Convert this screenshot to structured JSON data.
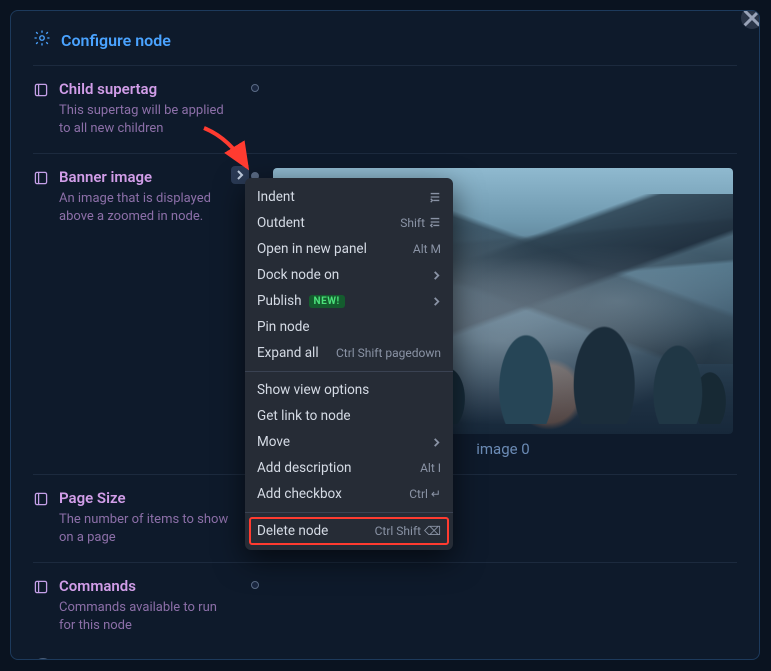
{
  "header": {
    "title": "Configure node"
  },
  "rows": {
    "child_supertag": {
      "title": "Child supertag",
      "desc": "This supertag will be applied to all new children"
    },
    "banner_image": {
      "title": "Banner image",
      "desc": "An image that is displayed above a zoomed in node.",
      "caption": "image 0"
    },
    "page_size": {
      "title": "Page Size",
      "desc": "The number of items to show on a page"
    },
    "commands": {
      "title": "Commands",
      "desc": "Commands available to run for this node"
    }
  },
  "context_menu": {
    "indent": {
      "label": "Indent",
      "shortcut": ""
    },
    "outdent": {
      "label": "Outdent",
      "shortcut": "Shift"
    },
    "open_panel": {
      "label": "Open in new panel",
      "shortcut": "Alt M"
    },
    "dock": {
      "label": "Dock node on",
      "shortcut": ""
    },
    "publish": {
      "label": "Publish",
      "badge": "NEW!"
    },
    "pin": {
      "label": "Pin node"
    },
    "expand_all": {
      "label": "Expand all",
      "shortcut": "Ctrl Shift pagedown"
    },
    "show_view_options": {
      "label": "Show view options"
    },
    "get_link": {
      "label": "Get link to node"
    },
    "move": {
      "label": "Move"
    },
    "add_description": {
      "label": "Add description",
      "shortcut": "Alt I"
    },
    "add_checkbox": {
      "label": "Add checkbox",
      "shortcut": "Ctrl ↵"
    },
    "delete_node": {
      "label": "Delete node",
      "shortcut": "Ctrl Shift ⌫"
    }
  }
}
